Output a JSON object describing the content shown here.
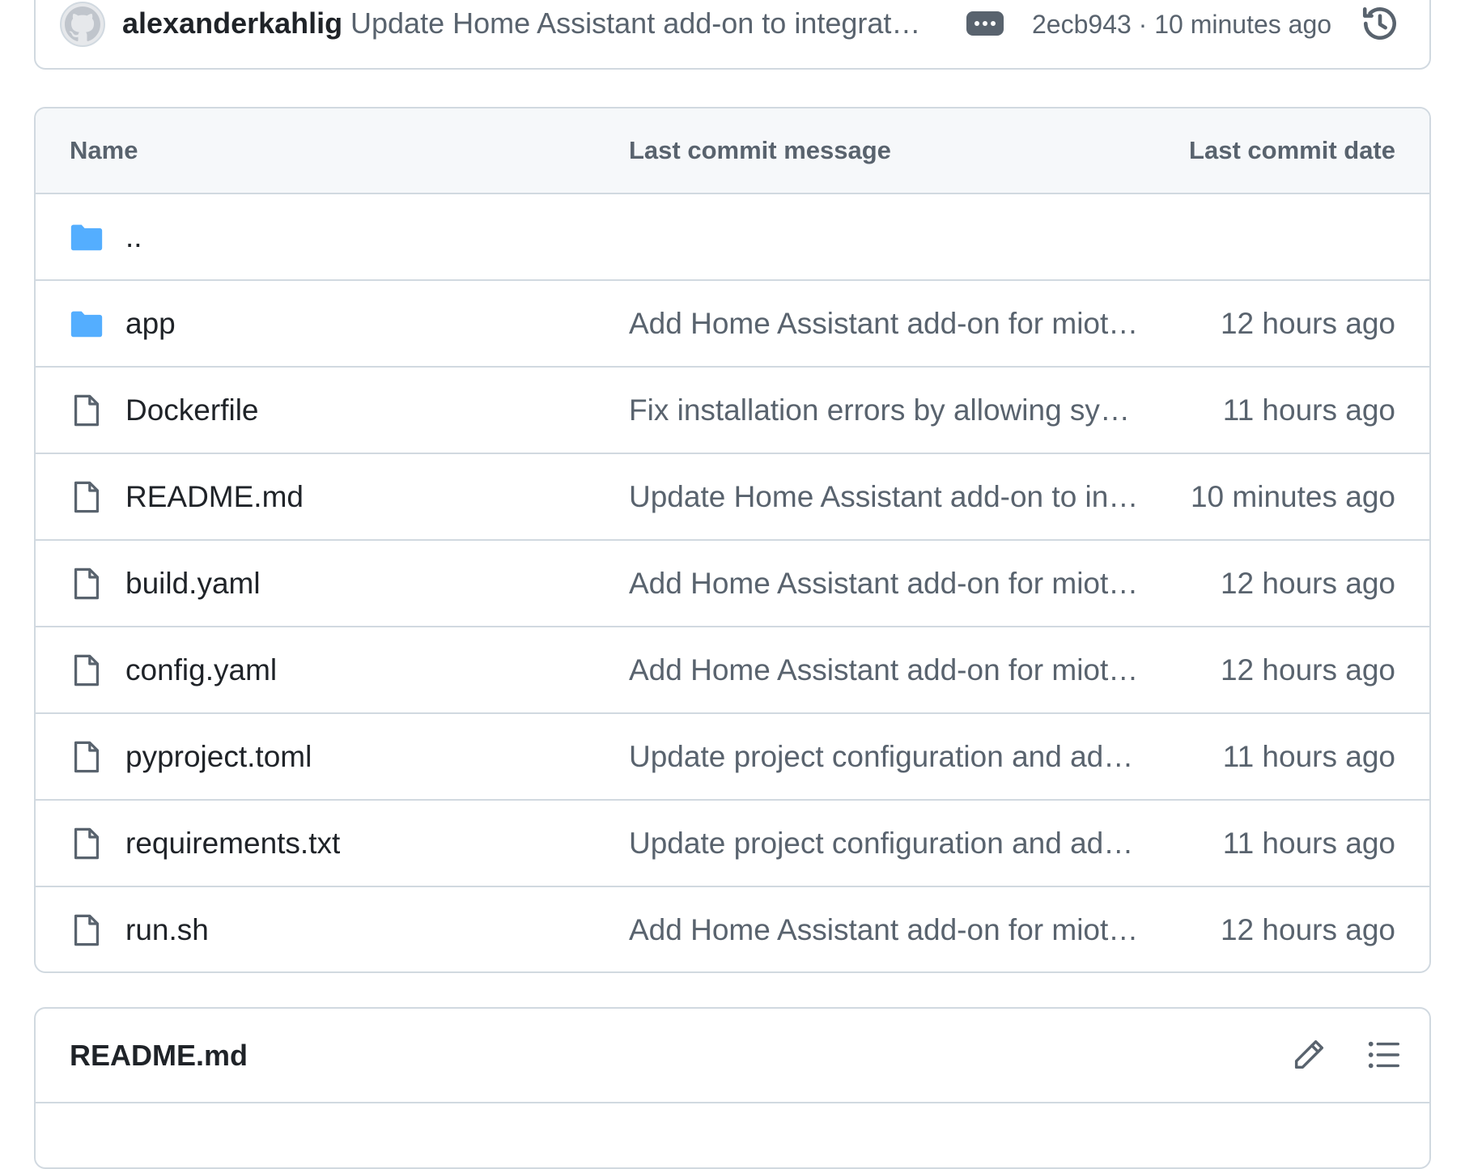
{
  "commit": {
    "author": "alexanderkahlig",
    "message": "Update Home Assistant add-on to integrat…",
    "meta": "2ecb943 · 10 minutes ago",
    "avatar_icon": "github-avatar-icon",
    "more_icon": "ellipsis-icon",
    "history_icon": "history-icon"
  },
  "table": {
    "headers": {
      "name": "Name",
      "message": "Last commit message",
      "date": "Last commit date"
    },
    "rows": [
      {
        "type": "parent",
        "name": "..",
        "message": "",
        "date": ""
      },
      {
        "type": "folder",
        "name": "app",
        "message": "Add Home Assistant add-on for miot…",
        "date": "12 hours ago"
      },
      {
        "type": "file",
        "name": "Dockerfile",
        "message": "Fix installation errors by allowing sys…",
        "date": "11 hours ago"
      },
      {
        "type": "file",
        "name": "README.md",
        "message": "Update Home Assistant add-on to int…",
        "date": "10 minutes ago"
      },
      {
        "type": "file",
        "name": "build.yaml",
        "message": "Add Home Assistant add-on for miot…",
        "date": "12 hours ago"
      },
      {
        "type": "file",
        "name": "config.yaml",
        "message": "Add Home Assistant add-on for miot…",
        "date": "12 hours ago"
      },
      {
        "type": "file",
        "name": "pyproject.toml",
        "message": "Update project configuration and add…",
        "date": "11 hours ago"
      },
      {
        "type": "file",
        "name": "requirements.txt",
        "message": "Update project configuration and add…",
        "date": "11 hours ago"
      },
      {
        "type": "file",
        "name": "run.sh",
        "message": "Add Home Assistant add-on for miot…",
        "date": "12 hours ago"
      }
    ]
  },
  "readme": {
    "title": "README.md",
    "edit_icon": "pencil-icon",
    "outline_icon": "list-icon"
  },
  "colors": {
    "folder": "#54aeff",
    "border": "#d1d9e0",
    "muted_text": "#59636e",
    "header_bg": "#f6f8fa"
  }
}
